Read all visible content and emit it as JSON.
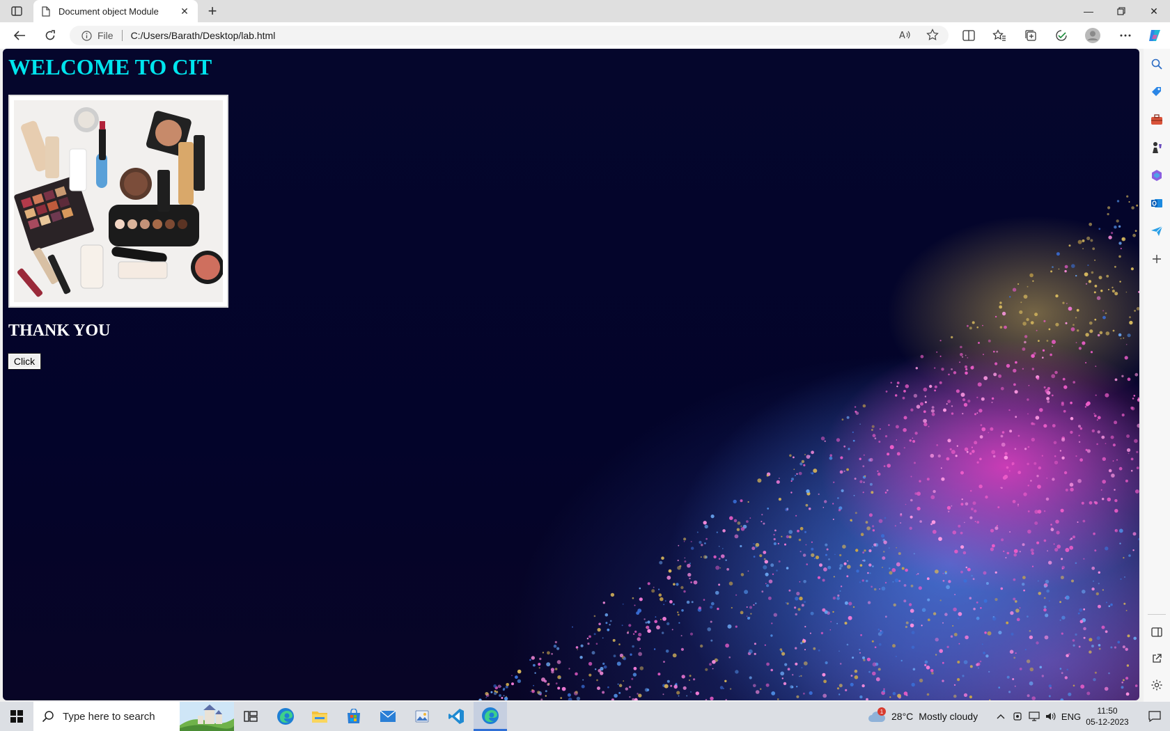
{
  "browser": {
    "tab_title": "Document object Module",
    "address_label": "File",
    "url": "C:/Users/Barath/Desktop/lab.html"
  },
  "page": {
    "heading": "WELCOME TO CIT",
    "image_description": "makeup-products-photo",
    "thank_you": "THANK YOU",
    "button_label": "Click",
    "heading_color": "#00e5ee"
  },
  "taskbar": {
    "search_placeholder": "Type here to search",
    "temperature": "28°C",
    "weather": "Mostly cloudy",
    "language": "ENG",
    "time": "11:50",
    "date": "05-12-2023",
    "weather_badge": "1"
  },
  "icons": {
    "sidebar": [
      "search-icon",
      "tag-icon",
      "toolbox-icon",
      "chess-icon",
      "office-icon",
      "outlook-icon",
      "send-icon",
      "add-icon",
      "panel-icon",
      "external-icon",
      "settings-icon"
    ]
  }
}
